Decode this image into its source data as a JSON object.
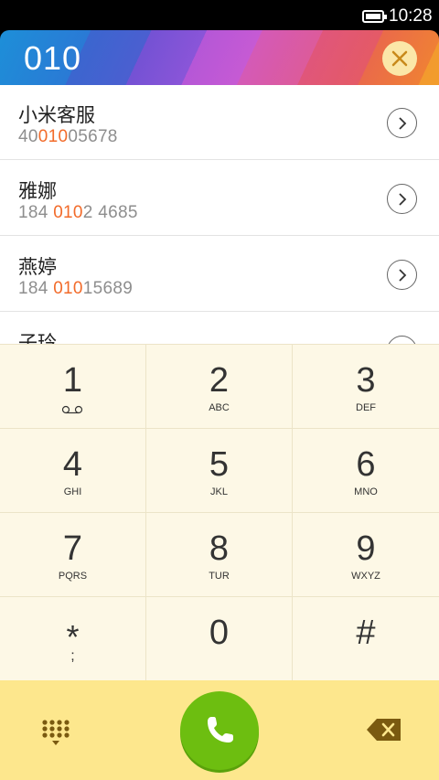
{
  "status_bar": {
    "time": "10:28"
  },
  "dial": {
    "input": "010"
  },
  "contacts": [
    {
      "name": "小米客服",
      "number_pre": "40",
      "number_match": "010",
      "number_post": "05678"
    },
    {
      "name": "雅娜",
      "number_pre": "184 ",
      "number_match": "010",
      "number_post": "2 4685"
    },
    {
      "name": "燕婷",
      "number_pre": "184 ",
      "number_match": "010",
      "number_post": "15689"
    },
    {
      "name": "子玲",
      "number_pre": "",
      "number_match": "",
      "number_post": ""
    }
  ],
  "keypad": {
    "k1": {
      "digit": "1",
      "letters": ""
    },
    "k2": {
      "digit": "2",
      "letters": "ABC"
    },
    "k3": {
      "digit": "3",
      "letters": "DEF"
    },
    "k4": {
      "digit": "4",
      "letters": "GHI"
    },
    "k5": {
      "digit": "5",
      "letters": "JKL"
    },
    "k6": {
      "digit": "6",
      "letters": "MNO"
    },
    "k7": {
      "digit": "7",
      "letters": "PQRS"
    },
    "k8": {
      "digit": "8",
      "letters": "TUR"
    },
    "k9": {
      "digit": "9",
      "letters": "WXYZ"
    },
    "kstar": {
      "digit": "*",
      "letters": ";"
    },
    "k0": {
      "digit": "0",
      "letters": ""
    },
    "khash": {
      "digit": "#",
      "letters": ""
    }
  },
  "icons": {
    "voicemail": "voicemail-icon",
    "close": "close-icon",
    "arrow": "chevron-right-icon",
    "call": "phone-icon",
    "dialpad": "dialpad-icon",
    "backspace": "backspace-icon"
  },
  "colors": {
    "match_highlight": "#f26b2a",
    "call_button": "#6dbe10",
    "keypad_bg": "#fdf8e6",
    "action_bar_bg": "#fde78d"
  }
}
